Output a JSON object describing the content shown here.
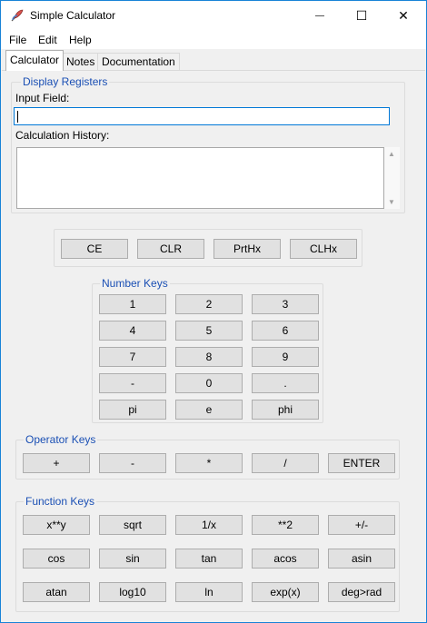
{
  "window": {
    "title": "Simple Calculator",
    "minimize_glyph": "—",
    "maximize_glyph": "☐",
    "close_glyph": "✕"
  },
  "menu": [
    "File",
    "Edit",
    "Help"
  ],
  "tabs": [
    "Calculator",
    "Notes",
    "Documentation"
  ],
  "active_tab": "Calculator",
  "display": {
    "group_title": "Display Registers",
    "input_label": "Input Field:",
    "input_value": "",
    "history_label": "Calculation History:",
    "history_value": "",
    "scroll_up": "▲",
    "scroll_down": "▼"
  },
  "register_buttons": [
    "CE",
    "CLR",
    "PrtHx",
    "CLHx"
  ],
  "number_keys": {
    "group_title": "Number Keys",
    "rows": [
      [
        "1",
        "2",
        "3"
      ],
      [
        "4",
        "5",
        "6"
      ],
      [
        "7",
        "8",
        "9"
      ],
      [
        "-",
        "0",
        "."
      ],
      [
        "pi",
        "e",
        "phi"
      ]
    ]
  },
  "operator_keys": {
    "group_title": "Operator Keys",
    "keys": [
      "+",
      "-",
      "*",
      "/",
      "ENTER"
    ]
  },
  "function_keys": {
    "group_title": "Function Keys",
    "rows": [
      [
        "x**y",
        "sqrt",
        "1/x",
        "**2",
        "+/-"
      ],
      [
        "cos",
        "sin",
        "tan",
        "acos",
        "asin"
      ],
      [
        "atan",
        "log10",
        "ln",
        "exp(x)",
        "deg>rad"
      ]
    ]
  },
  "colors": {
    "window_border": "#1883d7",
    "group_title": "#1a4fb4",
    "focus_border": "#0078d7",
    "button_face": "#e1e1e1"
  },
  "icons": {
    "app": "feather-pen-icon",
    "minimize": "minimize-icon",
    "maximize": "maximize-icon",
    "close": "close-icon"
  }
}
